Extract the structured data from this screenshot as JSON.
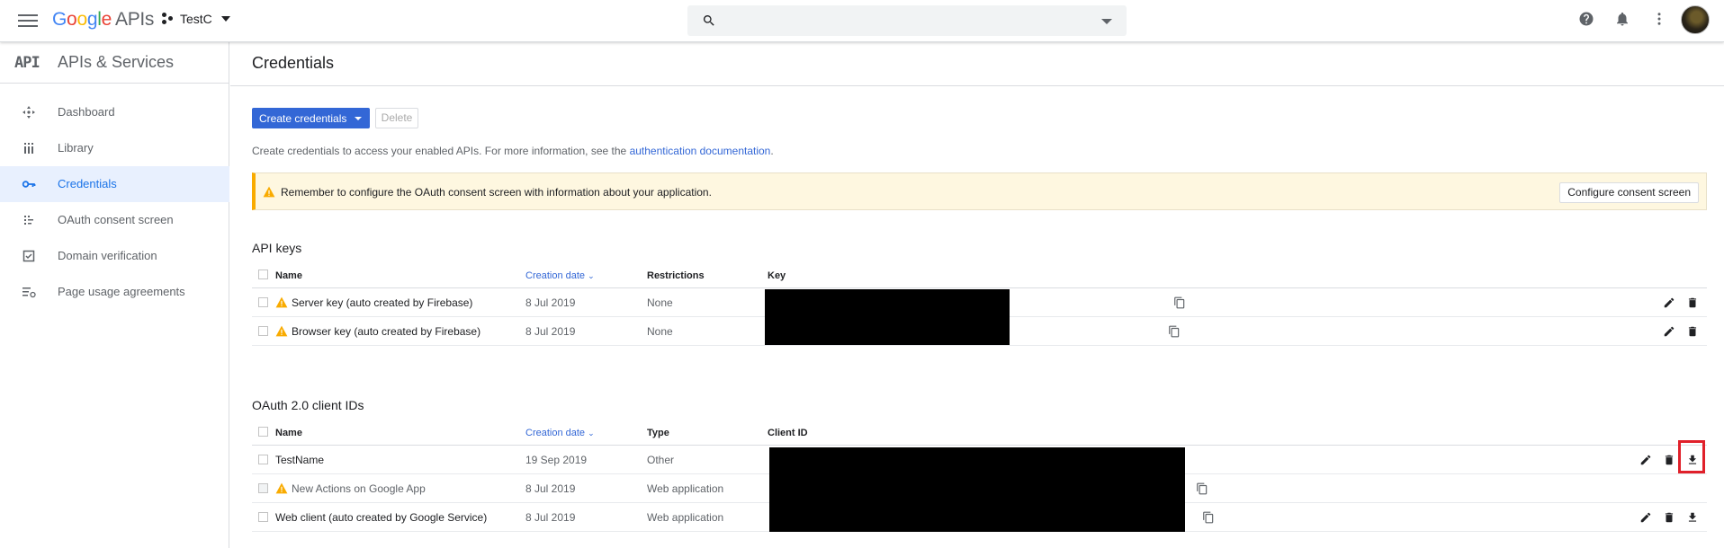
{
  "header": {
    "product_letters": [
      "G",
      "o",
      "o",
      "g",
      "l",
      "e"
    ],
    "product_suffix": "APIs",
    "project": "TestC",
    "search_placeholder": ""
  },
  "sidebar": {
    "mark": "API",
    "title": "APIs & Services",
    "items": [
      {
        "label": "Dashboard",
        "icon": "dashboard-icon",
        "active": false
      },
      {
        "label": "Library",
        "icon": "library-icon",
        "active": false
      },
      {
        "label": "Credentials",
        "icon": "key-icon",
        "active": true
      },
      {
        "label": "OAuth consent screen",
        "icon": "consent-icon",
        "active": false
      },
      {
        "label": "Domain verification",
        "icon": "check-box-icon",
        "active": false
      },
      {
        "label": "Page usage agreements",
        "icon": "settings-list-icon",
        "active": false
      }
    ]
  },
  "main": {
    "title": "Credentials",
    "create_button": "Create credentials",
    "delete_button": "Delete",
    "intro_text": "Create credentials to access your enabled APIs. For more information, see the",
    "intro_link": "authentication documentation",
    "intro_suffix": ".",
    "warning": {
      "text": "Remember to configure the OAuth consent screen with information about your application.",
      "button": "Configure consent screen"
    },
    "api_keys": {
      "title": "API keys",
      "columns": [
        "Name",
        "Creation date",
        "Restrictions",
        "Key"
      ],
      "rows": [
        {
          "name": "Server key (auto created by Firebase)",
          "date": "8 Jul 2019",
          "restrictions": "None",
          "warning": true
        },
        {
          "name": "Browser key (auto created by Firebase)",
          "date": "8 Jul 2019",
          "restrictions": "None",
          "warning": true
        }
      ]
    },
    "oauth": {
      "title": "OAuth 2.0 client IDs",
      "columns": [
        "Name",
        "Creation date",
        "Type",
        "Client ID"
      ],
      "rows": [
        {
          "name": "TestName",
          "date": "19 Sep 2019",
          "type": "Other",
          "warning": false
        },
        {
          "name": "New Actions on Google App",
          "date": "8 Jul 2019",
          "type": "Web application",
          "warning": true
        },
        {
          "name": "Web client (auto created by Google Service)",
          "date": "8 Jul 2019",
          "type": "Web application",
          "warning": false
        }
      ]
    }
  },
  "colors": {
    "primary": "#3367d6",
    "warning": "#f9ab00",
    "highlight": "#e0202a",
    "active_bg": "#e8f0fe"
  }
}
